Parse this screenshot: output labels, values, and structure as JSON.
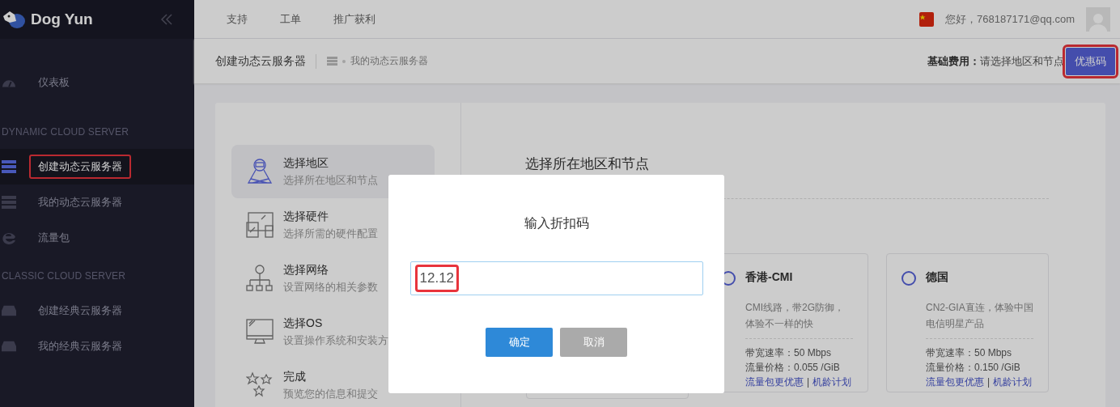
{
  "sidebar": {
    "brand": "Dog Yun",
    "groups": [
      {
        "items": [
          {
            "label": "仪表板",
            "selected": false
          }
        ]
      },
      {
        "heading": "DYNAMIC CLOUD SERVER",
        "items": [
          {
            "label": "创建动态云服务器",
            "selected": true
          },
          {
            "label": "我的动态云服务器",
            "selected": false
          },
          {
            "label": "流量包",
            "selected": false
          }
        ]
      },
      {
        "heading": "CLASSIC CLOUD SERVER",
        "items": [
          {
            "label": "创建经典云服务器",
            "selected": false
          },
          {
            "label": "我的经典云服务器",
            "selected": false
          }
        ]
      }
    ]
  },
  "topbar": {
    "links": [
      "支持",
      "工单",
      "推广获利"
    ],
    "greeting": "您好，768187171@qq.com"
  },
  "header": {
    "title": "创建动态云服务器",
    "breadcrumb": "我的动态云服务器",
    "fee_label": "基础费用：",
    "fee_value": "请选择地区和节点",
    "coupon_button": "优惠码"
  },
  "steps": [
    {
      "title": "选择地区",
      "subtitle": "选择所在地区和节点",
      "selected": true
    },
    {
      "title": "选择硬件",
      "subtitle": "选择所需的硬件配置",
      "selected": false
    },
    {
      "title": "选择网络",
      "subtitle": "设置网络的相关参数",
      "selected": false
    },
    {
      "title": "选择OS",
      "subtitle": "设置操作系统和安装方",
      "selected": false
    },
    {
      "title": "完成",
      "subtitle": "预览您的信息和提交",
      "selected": false
    }
  ],
  "panel": {
    "title": "选择所在地区和节点",
    "regions": [
      {
        "name": "香港-CMI",
        "description": "CMI线路，带2G防御，体验不一样的快",
        "bandwidth": "带宽速率：50 Mbps",
        "price": "流量价格：0.055 /GiB",
        "links": [
          "流量包更优惠",
          "机龄计划"
        ],
        "separator": "|",
        "selected": false
      },
      {
        "name": "德国",
        "description": "CN2-GIA直连，体验中国电信明星产品",
        "bandwidth": "带宽速率：50 Mbps",
        "price": "流量价格：0.150 /GiB",
        "links": [
          "流量包更优惠",
          "机龄计划"
        ],
        "separator": "|",
        "selected": false
      }
    ]
  },
  "dialog": {
    "title": "输入折扣码",
    "value": "12.12",
    "buttons": [
      {
        "label": "确定",
        "kind": "primary"
      },
      {
        "label": "取消",
        "kind": "secondary"
      }
    ]
  }
}
